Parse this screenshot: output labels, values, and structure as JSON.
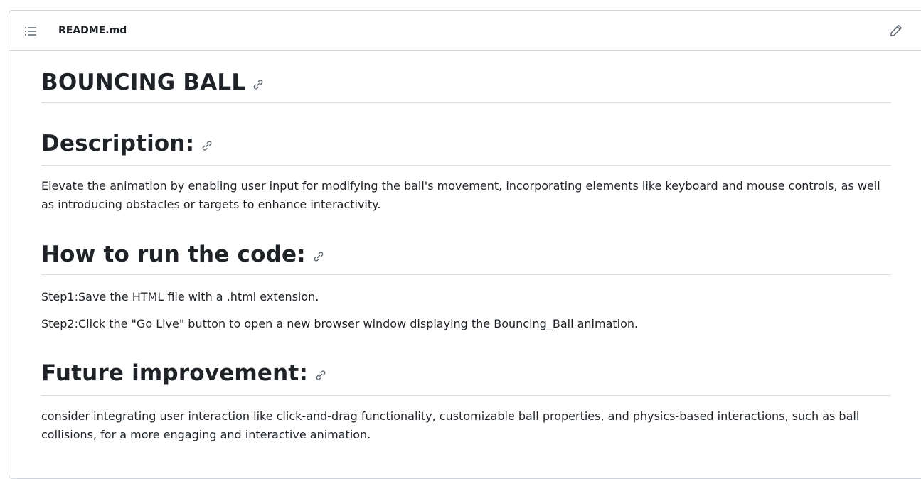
{
  "header": {
    "file_name": "README.md",
    "list_icon": "list-unordered-icon",
    "edit_icon": "pencil-icon"
  },
  "content": {
    "title": "BOUNCING BALL",
    "sections": [
      {
        "heading": "Description:",
        "paragraphs": [
          "Elevate the animation by enabling user input for modifying the ball's movement, incorporating elements like keyboard and mouse controls, as well as introducing obstacles or targets to enhance interactivity."
        ]
      },
      {
        "heading": "How to run the code:",
        "paragraphs": [
          "Step1:Save the HTML file with a .html extension.",
          "Step2:Click the \"Go Live\" button to open a new browser window displaying the Bouncing_Ball animation."
        ]
      },
      {
        "heading": "Future improvement:",
        "paragraphs": [
          "consider integrating user interaction like click-and-drag functionality, customizable ball properties, and physics-based interactions, such as ball collisions, for a more engaging and interactive animation."
        ]
      }
    ],
    "anchor_icon": "link-icon"
  },
  "colors": {
    "text": "#1f2328",
    "border": "#d0d7de",
    "icon": "#59636e"
  }
}
